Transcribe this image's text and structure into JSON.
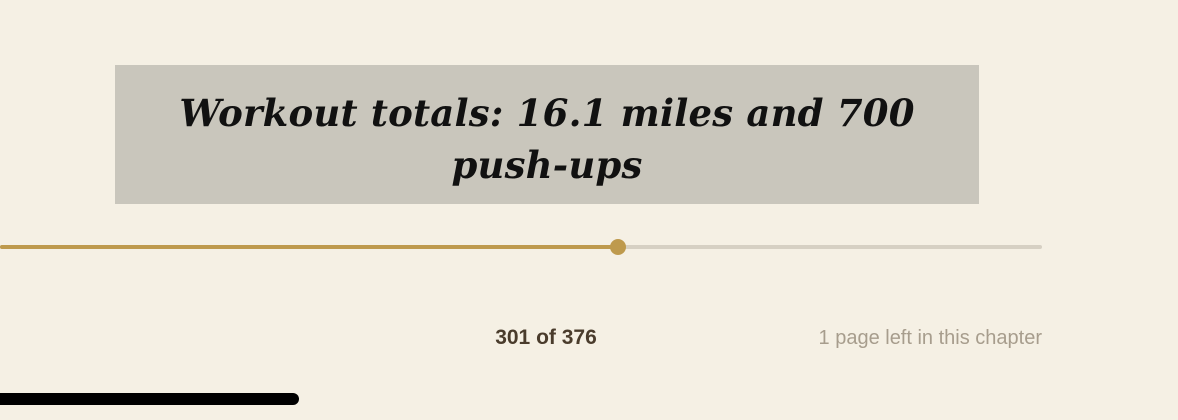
{
  "highlight": {
    "text": "Workout totals: 16.1 miles and 700 push-ups"
  },
  "progress": {
    "current_page": 301,
    "total_pages": 376,
    "fraction": 0.5935,
    "label": "301 of 376",
    "chapter_remaining": "1 page left in this chapter"
  },
  "colors": {
    "background": "#f5f0e4",
    "highlight_bg": "#c9c6bc",
    "accent": "#be9a4d",
    "track": "#d6d0c3",
    "page_label": "#4a3c2c",
    "muted_text": "#a79d8d"
  }
}
